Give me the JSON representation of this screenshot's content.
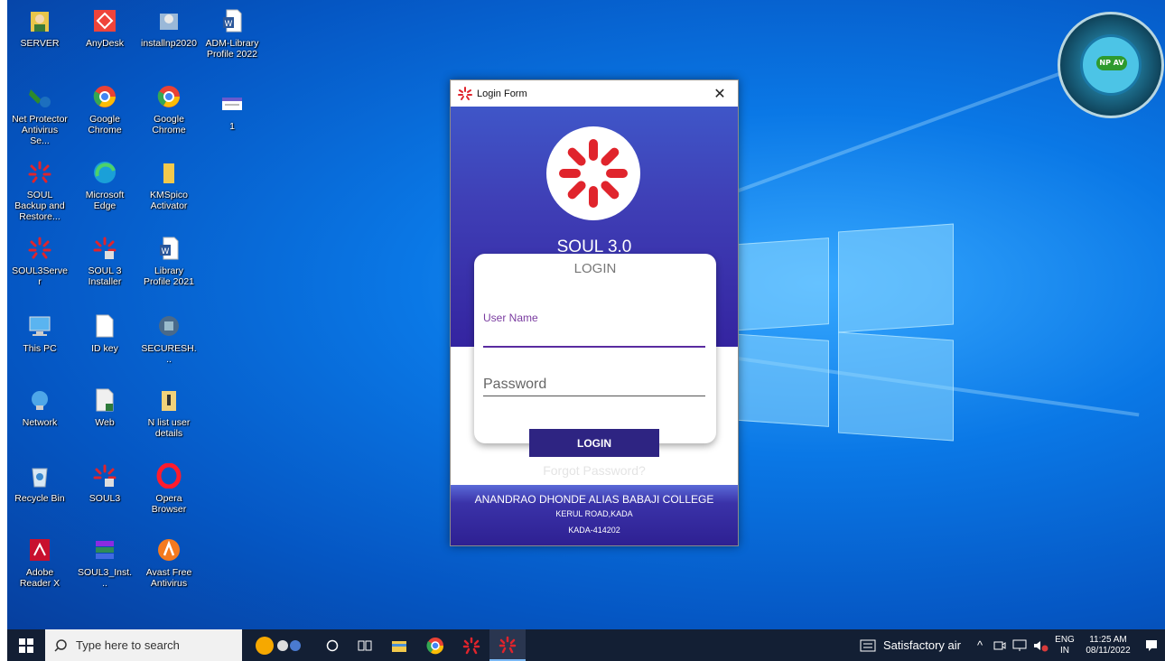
{
  "desktop": {
    "icons": [
      {
        "label": "SERVER",
        "icon": "user-folder-icon"
      },
      {
        "label": "AnyDesk",
        "icon": "anydesk-icon"
      },
      {
        "label": "installnp2020",
        "icon": "installer-icon"
      },
      {
        "label": "ADM-Library Profile 2022",
        "icon": "word-document-icon"
      },
      {
        "label": "Net Protector Antivirus Se...",
        "icon": "net-protector-icon"
      },
      {
        "label": "Google Chrome",
        "icon": "chrome-icon"
      },
      {
        "label": "Google Chrome",
        "icon": "chrome-icon"
      },
      {
        "label": "1",
        "icon": "calendar-file-icon"
      },
      {
        "label": "SOUL Backup and Restore...",
        "icon": "soul-icon"
      },
      {
        "label": "Microsoft Edge",
        "icon": "edge-icon"
      },
      {
        "label": "KMSpico Activator",
        "icon": "folder-icon"
      },
      {
        "label": "SOUL3Server",
        "icon": "soul-icon"
      },
      {
        "label": "SOUL 3 Installer",
        "icon": "soul-installer-icon"
      },
      {
        "label": "Library Profile 2021",
        "icon": "word-document-icon"
      },
      {
        "label": "This PC",
        "icon": "computer-icon"
      },
      {
        "label": "ID key",
        "icon": "text-file-icon"
      },
      {
        "label": "SECURESH...",
        "icon": "secure-shortcut-icon"
      },
      {
        "label": "Network",
        "icon": "network-icon"
      },
      {
        "label": "Web",
        "icon": "file-icon"
      },
      {
        "label": "N list user details",
        "icon": "zip-folder-icon"
      },
      {
        "label": "Recycle Bin",
        "icon": "recycle-bin-icon"
      },
      {
        "label": "SOUL3",
        "icon": "soul-installer-icon"
      },
      {
        "label": "Opera Browser",
        "icon": "opera-icon"
      },
      {
        "label": "Adobe Reader X",
        "icon": "adobe-reader-icon"
      },
      {
        "label": "SOUL3_Inst...",
        "icon": "winrar-icon"
      },
      {
        "label": "Avast Free Antivirus",
        "icon": "avast-icon"
      }
    ],
    "antivirus_widget": {
      "badge": "NP AV"
    }
  },
  "login_window": {
    "title": "Login Form",
    "close": "✕",
    "app_name": "SOUL 3.0",
    "card_title": "LOGIN",
    "username_label": "User Name",
    "username_value": "",
    "password_placeholder": "Password",
    "login_button": "LOGIN",
    "forgot_link": "Forgot Password?",
    "college_name": "ANANDRAO DHONDE ALIAS BABAJI COLLEGE",
    "college_address": "KERUL ROAD,KADA",
    "college_pin": "KADA-414202"
  },
  "taskbar": {
    "search_placeholder": "Type here to search",
    "weather": "Satisfactory air",
    "language_top": "ENG",
    "language_bottom": "IN",
    "time": "11:25 AM",
    "date": "08/11/2022"
  },
  "colors": {
    "accent_purple": "#2e2482",
    "taskbar": "#131f34",
    "soul_red": "#e0242c"
  }
}
